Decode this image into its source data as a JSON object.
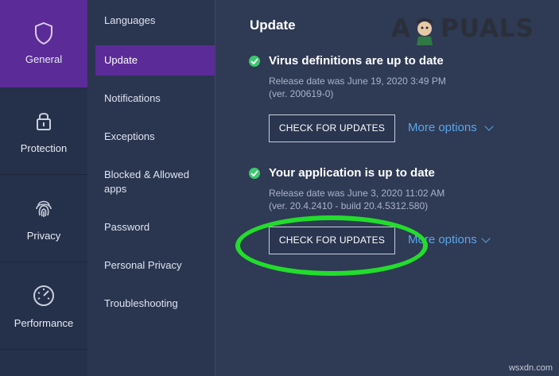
{
  "sidebar": {
    "items": [
      {
        "label": "General",
        "icon": "shield-icon"
      },
      {
        "label": "Protection",
        "icon": "lock-icon"
      },
      {
        "label": "Privacy",
        "icon": "fingerprint-icon"
      },
      {
        "label": "Performance",
        "icon": "speedometer-icon"
      }
    ],
    "active": "General"
  },
  "subnav": {
    "items": [
      "Languages",
      "Update",
      "Notifications",
      "Exceptions",
      "Blocked & Allowed apps",
      "Password",
      "Personal Privacy",
      "Troubleshooting"
    ],
    "active": "Update"
  },
  "main": {
    "title": "Update",
    "virus": {
      "heading": "Virus definitions are up to date",
      "release": "Release date was June 19, 2020 3:49 PM",
      "version": "(ver. 200619-0)",
      "button": "CHECK FOR UPDATES",
      "more": "More options"
    },
    "app": {
      "heading": "Your application is up to date",
      "release": "Release date was June 3, 2020 11:02 AM",
      "version": "(ver. 20.4.2410 - build 20.4.5312.580)",
      "button": "CHECK FOR UPDATES",
      "more": "More options"
    }
  },
  "branding": {
    "logo_left": "A",
    "logo_right": "PUALS",
    "watermark": "wsxdn.com"
  },
  "colors": {
    "active_purple": "#5b2b97",
    "link_blue": "#5aa6ea",
    "check_green": "#3ec66f",
    "highlight_green": "#22dd2c"
  }
}
